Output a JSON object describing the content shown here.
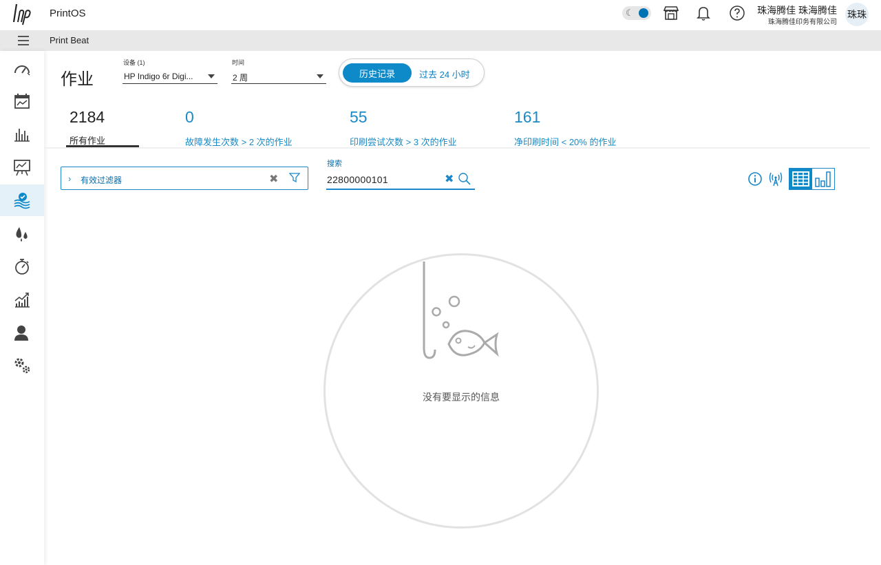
{
  "app": {
    "name": "PrintOS",
    "section": "Print Beat"
  },
  "user": {
    "name": "珠海腾佳 珠海腾佳",
    "company": "珠海腾佳印务有限公司",
    "avatar_initials": "珠珠"
  },
  "top_icons": [
    "moon-icon",
    "store-icon",
    "bell-icon",
    "help-icon"
  ],
  "sidebar": {
    "items": [
      {
        "icon": "gauge-icon",
        "active": false
      },
      {
        "icon": "calendar-chart-icon",
        "active": false
      },
      {
        "icon": "bar-chart-icon",
        "active": false
      },
      {
        "icon": "presentation-chart-icon",
        "active": false
      },
      {
        "icon": "jobs-check-icon",
        "active": true
      },
      {
        "icon": "ink-drops-icon",
        "active": false
      },
      {
        "icon": "stopwatch-icon",
        "active": false
      },
      {
        "icon": "trend-chart-icon",
        "active": false
      },
      {
        "icon": "user-icon",
        "active": false
      },
      {
        "icon": "gears-icon",
        "active": false
      }
    ]
  },
  "page": {
    "title": "作业"
  },
  "device_select": {
    "label": "设备 (1)",
    "value": "HP Indigo 6r Digi..."
  },
  "time_select": {
    "label": "时间",
    "value": "2 周"
  },
  "mode_toggle": {
    "active": "历史记录",
    "inactive": "过去 24 小时"
  },
  "stats": [
    {
      "value": "2184",
      "label": "所有作业",
      "active": true
    },
    {
      "value": "0",
      "label": "故障发生次数 > 2 次的作业",
      "active": false
    },
    {
      "value": "55",
      "label": "印刷尝试次数 > 3 次的作业",
      "active": false
    },
    {
      "value": "161",
      "label": "净印刷时间 < 20% 的作业",
      "active": false
    }
  ],
  "filter": {
    "label": "有效过滤器",
    "clear_symbol": "✖"
  },
  "search": {
    "label": "搜索",
    "value": "22800000101",
    "clear_symbol": "✖"
  },
  "empty_state": {
    "message": "没有要显示的信息"
  },
  "colors": {
    "accent": "#0f8ac9",
    "link": "#0f7fc1",
    "text": "#222222",
    "stat_link": "#1a8ac6"
  }
}
